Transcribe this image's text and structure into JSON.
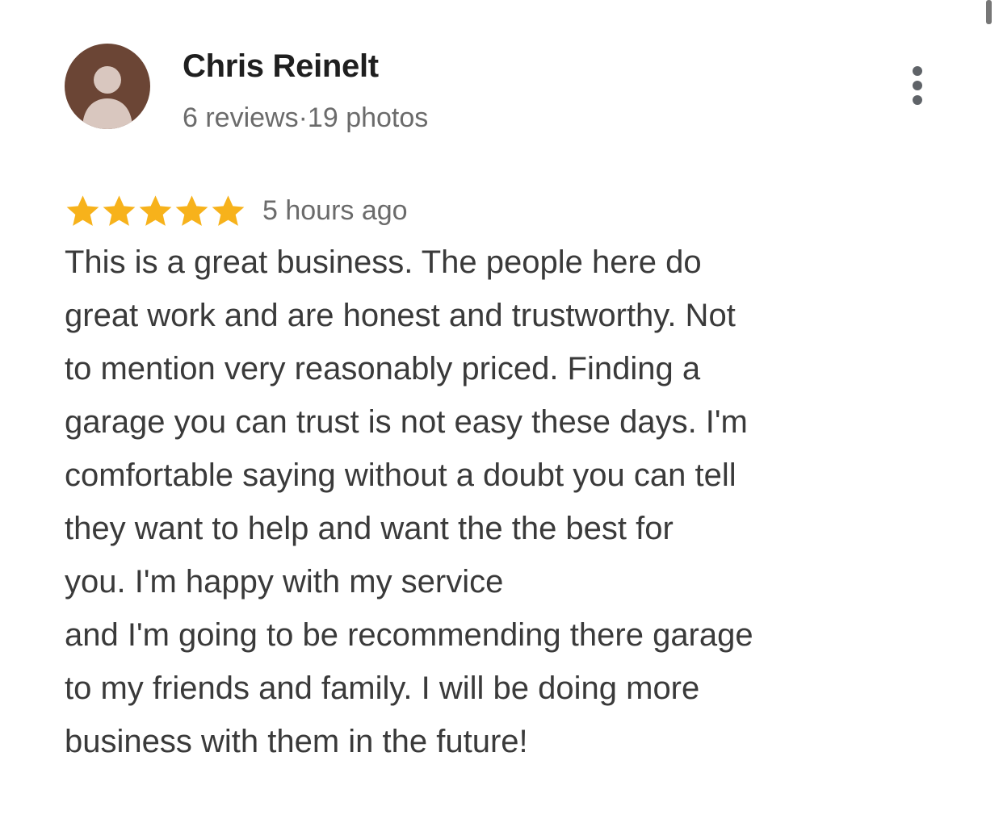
{
  "review": {
    "author": {
      "name": "Chris Reinelt",
      "meta": "6 reviews·19 photos",
      "avatar_icon": "person-icon",
      "avatar_color": "#6b4535"
    },
    "rating": {
      "stars": 5,
      "max_stars": 5,
      "star_color": "#f7b21b"
    },
    "time": "5 hours ago",
    "text": "This is a great business. The people here do\ngreat work and are honest and trustworthy. Not\nto mention very reasonably priced. Finding a\ngarage you can trust is not easy these days. I'm\ncomfortable saying without a doubt you can tell\nthey want to help  and want the the best for\nyou. I'm happy with my service\nand I'm going to be recommending there garage\nto my friends and family. I will be doing more\nbusiness with them in the future!",
    "menu_icon": "more-vertical-icon"
  }
}
